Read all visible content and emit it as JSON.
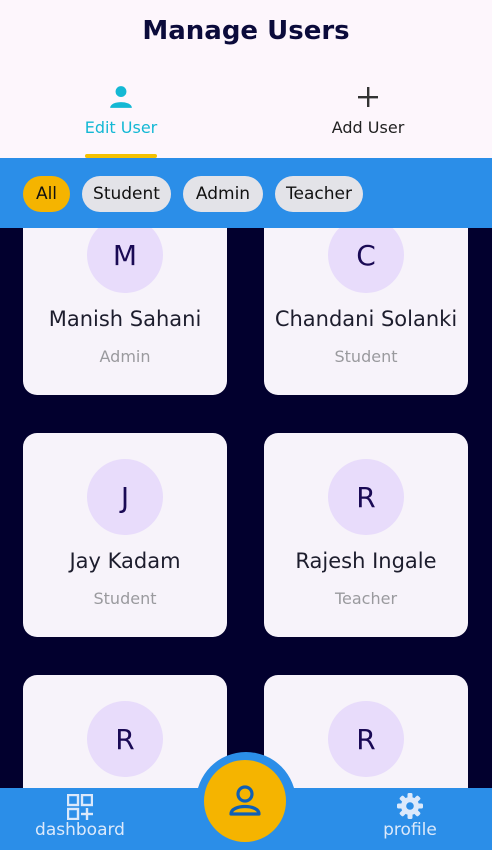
{
  "header": {
    "title": "Manage Users",
    "tabs": [
      {
        "label": "Edit User",
        "icon": "person-icon",
        "active": true
      },
      {
        "label": "Add User",
        "icon": "plus-icon",
        "active": false
      }
    ]
  },
  "filters": [
    {
      "label": "All",
      "active": true
    },
    {
      "label": "Student",
      "active": false
    },
    {
      "label": "Admin",
      "active": false
    },
    {
      "label": "Teacher",
      "active": false
    }
  ],
  "users": [
    {
      "initial": "M",
      "name": "Manish Sahani",
      "role": "Admin"
    },
    {
      "initial": "C",
      "name": "Chandani Solanki",
      "role": "Student"
    },
    {
      "initial": "J",
      "name": "Jay Kadam",
      "role": "Student"
    },
    {
      "initial": "R",
      "name": "Rajesh Ingale",
      "role": "Teacher"
    },
    {
      "initial": "R",
      "name": "",
      "role": ""
    },
    {
      "initial": "R",
      "name": "",
      "role": ""
    }
  ],
  "bottom_nav": {
    "dashboard_label": "dashboard",
    "profile_label": "profile",
    "fab_icon": "user-icon"
  },
  "colors": {
    "accent_blue": "#2b8ee8",
    "accent_yellow": "#f5b400",
    "active_tab": "#14b8d4",
    "background": "#02002e"
  }
}
